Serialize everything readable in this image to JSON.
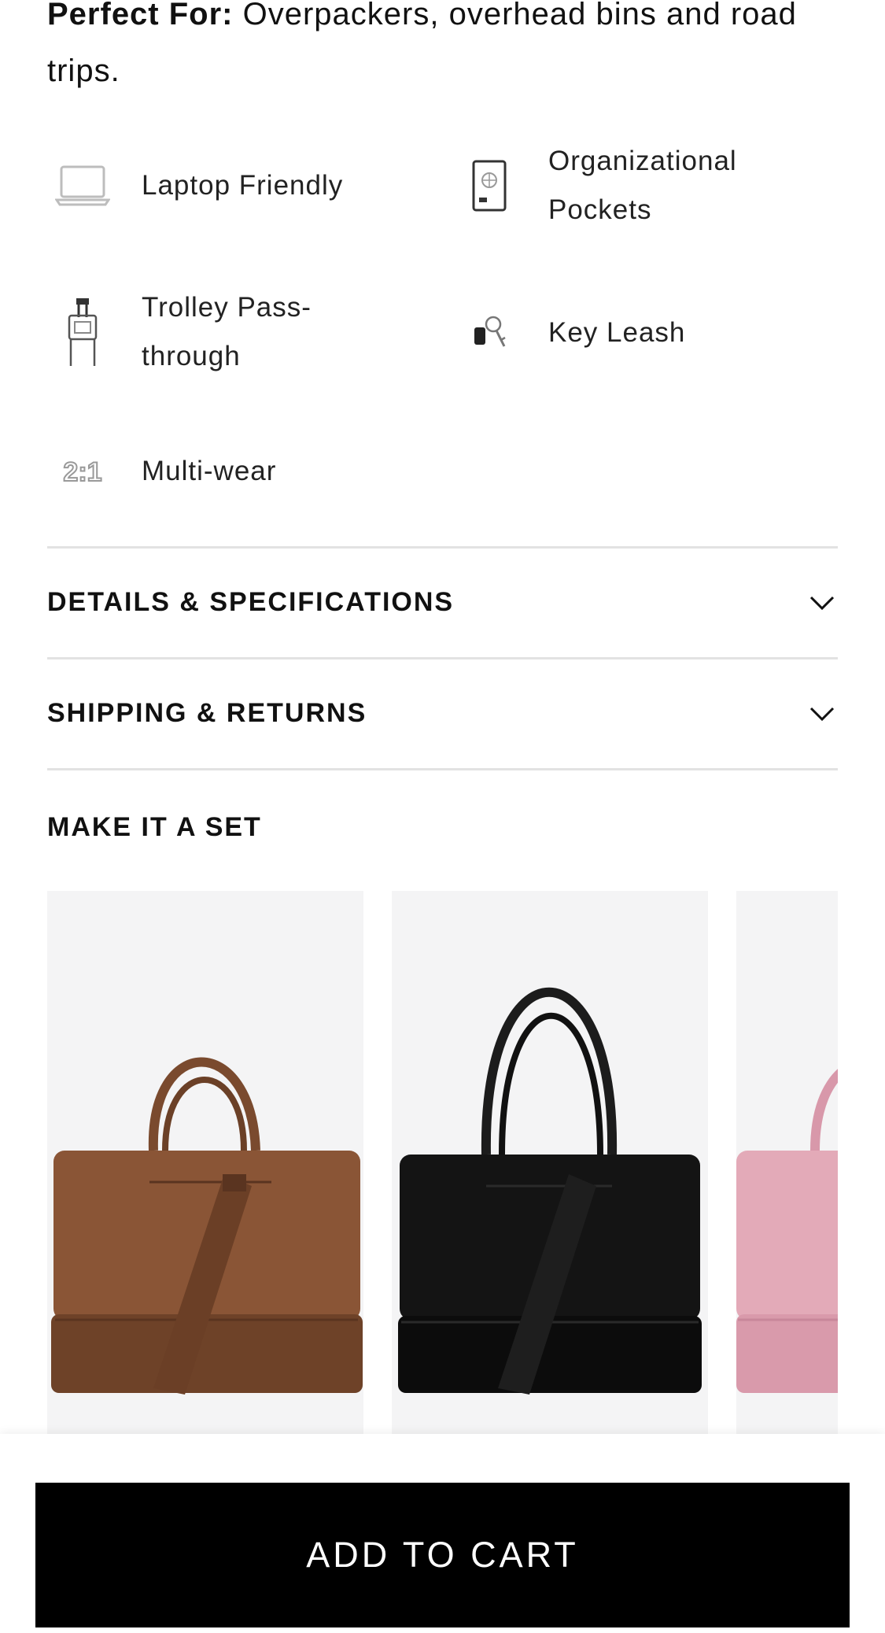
{
  "description": {
    "perfect_for_label": "Perfect For:",
    "perfect_for_text": " Overpackers, overhead bins and road trips."
  },
  "features": [
    {
      "label": "Laptop Friendly",
      "icon": "laptop-icon"
    },
    {
      "label": "Organizational Pockets",
      "icon": "passport-icon"
    },
    {
      "label": "Trolley Pass-through",
      "icon": "trolley-icon"
    },
    {
      "label": "Key Leash",
      "icon": "keys-icon"
    },
    {
      "label": "Multi-wear",
      "icon": "two-in-one-icon"
    }
  ],
  "accordions": [
    {
      "title": "DETAILS & SPECIFICATIONS"
    },
    {
      "title": "SHIPPING & RETURNS"
    }
  ],
  "make_set": {
    "title": "MAKE IT A SET",
    "products": [
      {
        "color_name": "brown",
        "color": "#8a5536"
      },
      {
        "color_name": "black",
        "color": "#141414"
      },
      {
        "color_name": "pink",
        "color": "#e3aab8"
      }
    ]
  },
  "cart": {
    "button_label": "ADD TO CART"
  },
  "colors": {
    "button_bg": "#000000",
    "button_text": "#ffffff",
    "divider": "#e2e2e2",
    "card_bg": "#f4f4f5"
  }
}
